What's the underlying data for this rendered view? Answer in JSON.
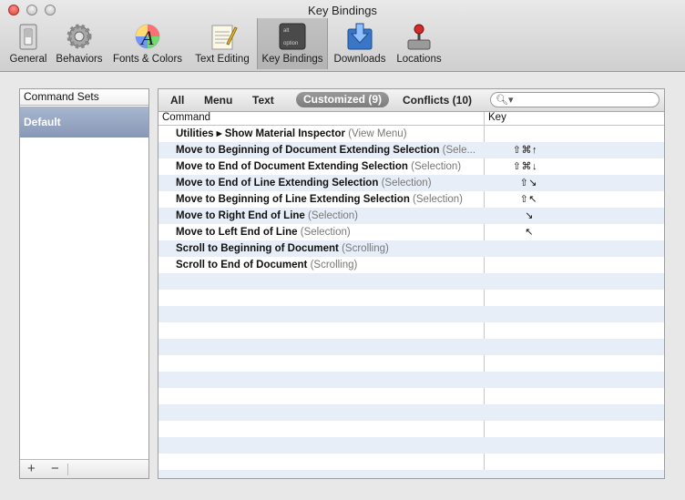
{
  "window": {
    "title": "Key Bindings"
  },
  "toolbar": {
    "items": [
      {
        "label": "General",
        "icon": "light-switch-icon"
      },
      {
        "label": "Behaviors",
        "icon": "gear-icon"
      },
      {
        "label": "Fonts & Colors",
        "icon": "font-color-icon"
      },
      {
        "label": "Text Editing",
        "icon": "notepad-pencil-icon"
      },
      {
        "label": "Key Bindings",
        "icon": "option-key-icon",
        "selected": true
      },
      {
        "label": "Downloads",
        "icon": "downloads-icon"
      },
      {
        "label": "Locations",
        "icon": "joystick-icon"
      }
    ],
    "key_top": "alt",
    "key_bottom": "option"
  },
  "sidebar": {
    "header": "Command Sets",
    "items": [
      "Default"
    ],
    "add_label": "+",
    "remove_label": "−"
  },
  "filters": {
    "all": "All",
    "menu": "Menu",
    "text": "Text",
    "customized": "Customized (9)",
    "conflicts": "Conflicts (10)",
    "active": "customized"
  },
  "search": {
    "placeholder": "",
    "value": ""
  },
  "table": {
    "columns": [
      "Command",
      "Key"
    ],
    "rows": [
      {
        "command": "Utilities ▸ Show Material Inspector",
        "group": "(View Menu)",
        "key": ""
      },
      {
        "command": "Move to Beginning of Document Extending Selection",
        "group": "(Sele...",
        "key": "⇧⌘↑"
      },
      {
        "command": "Move to End of Document Extending Selection",
        "group": "(Selection)",
        "key": "⇧⌘↓"
      },
      {
        "command": "Move to End of Line Extending Selection",
        "group": "(Selection)",
        "key": "⇧↘"
      },
      {
        "command": "Move to Beginning of Line Extending Selection",
        "group": "(Selection)",
        "key": "⇧↖"
      },
      {
        "command": "Move to Right End of Line",
        "group": "(Selection)",
        "key": "↘"
      },
      {
        "command": "Move to Left End of Line",
        "group": "(Selection)",
        "key": "↖"
      },
      {
        "command": "Scroll to Beginning of Document",
        "group": "(Scrolling)",
        "key": ""
      },
      {
        "command": "Scroll to End of Document",
        "group": "(Scrolling)",
        "key": ""
      }
    ]
  },
  "colors": {
    "selection": "#8797b6",
    "stripe": "#e8eef8",
    "filter_active": "#8a8a8a"
  }
}
